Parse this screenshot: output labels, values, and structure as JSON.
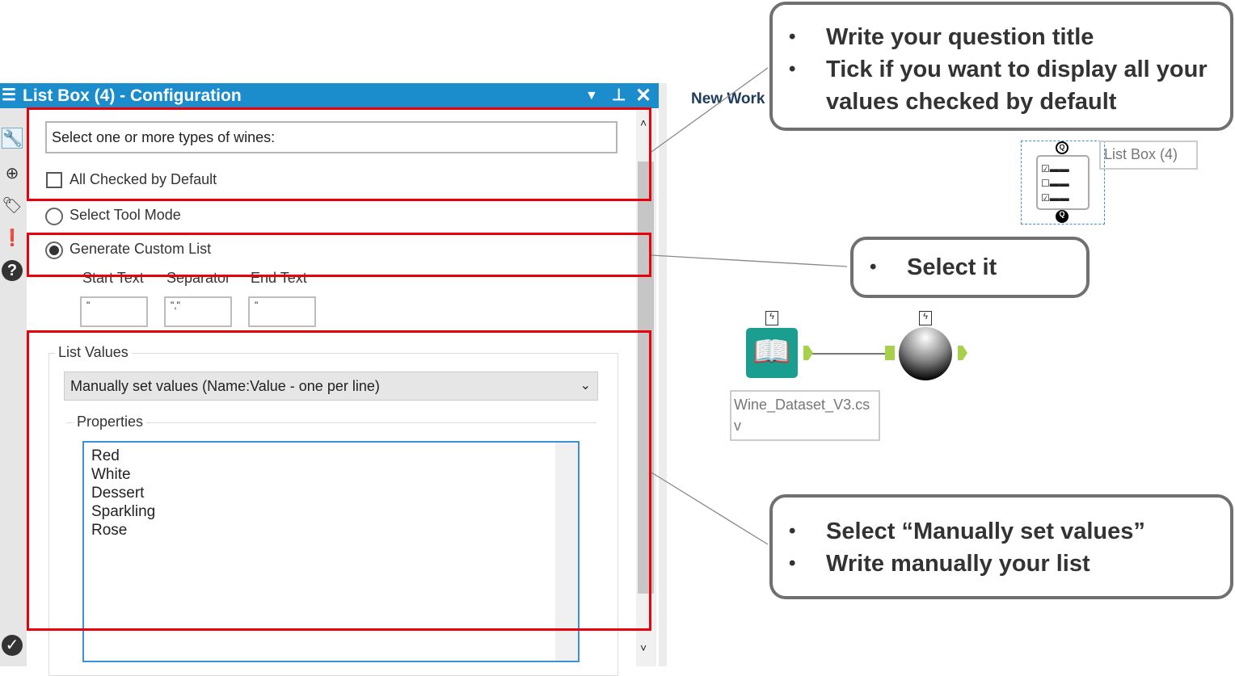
{
  "panel": {
    "title": "List Box (4) - Configuration",
    "question_title": "Select one or more types of wines:",
    "all_checked_label": "All Checked by Default",
    "all_checked": false,
    "mode_options": [
      "Select Tool Mode",
      "Generate Custom List"
    ],
    "selected_mode": "Generate Custom List",
    "start_text_label": "Start Text",
    "separator_label": "Separator",
    "end_text_label": "End Text",
    "start_text_value": "\"",
    "separator_value": "\",\"",
    "end_text_value": "\"",
    "list_values_label": "List Values",
    "list_values_select": "Manually set values (Name:Value - one per line)",
    "properties_label": "Properties",
    "properties_lines": [
      "Red",
      "White",
      "Dessert",
      "Sparkling",
      "Rose"
    ]
  },
  "canvas": {
    "tab_label": "New Work",
    "listbox_label": "List Box (4)",
    "input_label": "Wine_Dataset_V3.csv",
    "accent": "#1a9e8f"
  },
  "callouts": [
    {
      "items": [
        "Write your question title",
        "Tick if you want to display all your values checked by default"
      ]
    },
    {
      "items": [
        "Select it"
      ]
    },
    {
      "items": [
        "Select “Manually set values”",
        "Write manually your list"
      ]
    }
  ],
  "colors": {
    "titlebar": "#1b8dcc",
    "highlight": "#e8000b"
  }
}
